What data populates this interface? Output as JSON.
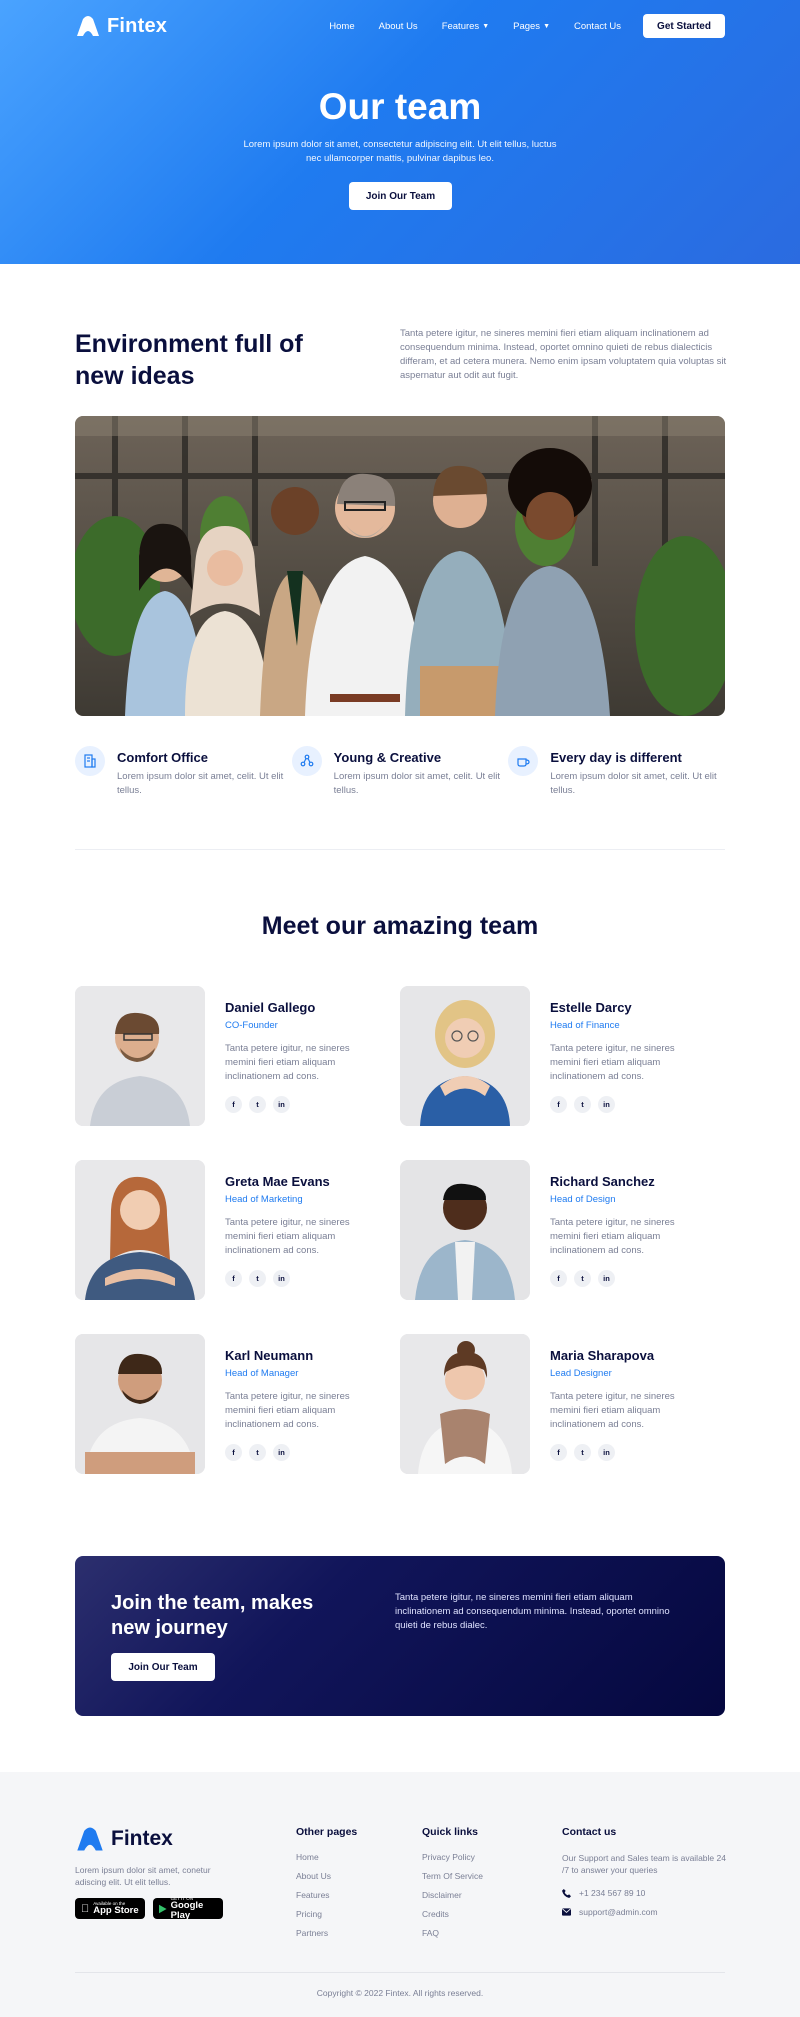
{
  "nav": {
    "brand": "Fintex",
    "links": [
      {
        "label": "Home"
      },
      {
        "label": "About Us"
      },
      {
        "label": "Features",
        "dropdown": true
      },
      {
        "label": "Pages",
        "dropdown": true
      },
      {
        "label": "Contact Us"
      }
    ],
    "cta": "Get Started"
  },
  "hero": {
    "title": "Our team",
    "subtitle": "Lorem ipsum dolor sit amet, consectetur adipiscing elit. Ut elit tellus, luctus nec ullamcorper mattis, pulvinar dapibus leo.",
    "button": "Join Our Team"
  },
  "environment": {
    "title": "Environment full of new ideas",
    "text": "Tanta petere igitur, ne sineres memini fieri etiam aliquam inclinationem ad consequendum minima. Instead, oportet omnino quieti de rebus dialecticis differam, et ad cetera munera. Nemo enim ipsam voluptatem quia voluptas sit aspernatur aut odit aut fugit."
  },
  "features": [
    {
      "title": "Comfort Office",
      "text": "Lorem ipsum dolor sit amet, celit. Ut elit tellus.",
      "icon": "building-icon"
    },
    {
      "title": "Young & Creative",
      "text": "Lorem ipsum dolor sit amet, celit. Ut elit tellus.",
      "icon": "network-icon"
    },
    {
      "title": "Every day is different",
      "text": "Lorem ipsum dolor sit amet, celit. Ut elit tellus.",
      "icon": "coffee-icon"
    }
  ],
  "team": {
    "title": "Meet our amazing team",
    "members": [
      {
        "name": "Daniel Gallego",
        "role": "CO-Founder",
        "bio": "Tanta petere igitur, ne sineres memini fieri etiam aliquam inclinationem ad cons."
      },
      {
        "name": "Estelle Darcy",
        "role": "Head of Finance",
        "bio": "Tanta petere igitur, ne sineres memini fieri etiam aliquam inclinationem ad cons."
      },
      {
        "name": "Greta Mae Evans",
        "role": "Head of Marketing",
        "bio": "Tanta petere igitur, ne sineres memini fieri etiam aliquam inclinationem ad cons."
      },
      {
        "name": "Richard Sanchez",
        "role": "Head of Design",
        "bio": "Tanta petere igitur, ne sineres memini fieri etiam aliquam inclinationem ad cons."
      },
      {
        "name": "Karl Neumann",
        "role": "Head of Manager",
        "bio": "Tanta petere igitur, ne sineres memini fieri etiam aliquam inclinationem ad cons."
      },
      {
        "name": "Maria Sharapova",
        "role": "Lead Designer",
        "bio": "Tanta petere igitur, ne sineres memini fieri etiam aliquam inclinationem ad cons."
      }
    ],
    "social_labels": [
      "f",
      "t",
      "in"
    ]
  },
  "join": {
    "title": "Join the team, makes new journey",
    "button": "Join Our Team",
    "text": "Tanta petere igitur, ne sineres memini fieri etiam aliquam inclinationem ad consequendum minima. Instead, oportet omnino quieti de rebus dialec."
  },
  "footer": {
    "brand": "Fintex",
    "description": "Lorem ipsum dolor sit amet, conetur adiscing elit. Ut elit tellus.",
    "app_store": {
      "small": "Available on the",
      "big": "App Store"
    },
    "google_play": {
      "small": "GET IT ON",
      "big": "Google Play"
    },
    "other_pages": {
      "title": "Other pages",
      "links": [
        "Home",
        "About Us",
        "Features",
        "Pricing",
        "Partners"
      ]
    },
    "quick_links": {
      "title": "Quick links",
      "links": [
        "Privacy Policy",
        "Term Of Service",
        "Disclaimer",
        "Credits",
        "FAQ"
      ]
    },
    "contact": {
      "title": "Contact us",
      "text": "Our Support and Sales team is available 24 /7 to answer your queries",
      "phone": "+1 234 567 89 10",
      "email": "support@admin.com"
    },
    "copyright": "Copyright © 2022 Fintex. All rights reserved."
  },
  "colors": {
    "primary": "#1f7bf0",
    "navy": "#0a0f3d",
    "banner": "#05083f",
    "muted": "#7a7f95"
  }
}
